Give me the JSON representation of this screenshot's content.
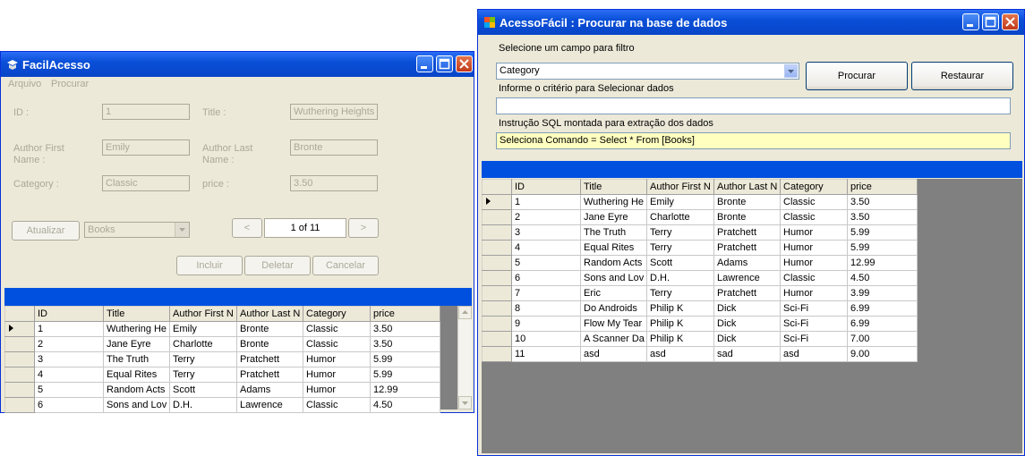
{
  "colors": {
    "title_blue": "#0a4fd8",
    "band_blue": "#0050e0",
    "window_bg": "#ece9d8",
    "sql_bg": "#ffffc0",
    "grid_area": "#808080"
  },
  "left_window": {
    "title": "FacilAcesso",
    "menu": [
      "Arquivo",
      "Procurar"
    ],
    "fields": {
      "id_label": "ID :",
      "id_value": "1",
      "title_label": "Title :",
      "title_value": "Wuthering Heights",
      "author_first_label": "Author First Name :",
      "author_first_value": "Emily",
      "author_last_label": "Author Last Name :",
      "author_last_value": "Bronte",
      "category_label": "Category :",
      "category_value": "Classic",
      "price_label": "price :",
      "price_value": "3.50"
    },
    "atualizar": "Atualizar",
    "table_select": "Books",
    "nav_prev": "<",
    "nav_position": "1 of 11",
    "nav_next": ">",
    "incluir": "Incluir",
    "deletar": "Deletar",
    "cancelar": "Cancelar",
    "grid": {
      "headers": [
        "ID",
        "Title",
        "Author First N",
        "Author Last N",
        "Category",
        "price"
      ],
      "rows": [
        [
          "1",
          "Wuthering He",
          "Emily",
          "Bronte",
          "Classic",
          "3.50"
        ],
        [
          "2",
          "Jane Eyre",
          "Charlotte",
          "Bronte",
          "Classic",
          "3.50"
        ],
        [
          "3",
          "The Truth",
          "Terry",
          "Pratchett",
          "Humor",
          "5.99"
        ],
        [
          "4",
          "Equal Rites",
          "Terry",
          "Pratchett",
          "Humor",
          "5.99"
        ],
        [
          "5",
          "Random Acts",
          "Scott",
          "Adams",
          "Humor",
          "12.99"
        ],
        [
          "6",
          "Sons and Lov",
          "D.H.",
          "Lawrence",
          "Classic",
          "4.50"
        ]
      ]
    }
  },
  "right_window": {
    "title": "AcessoFácil : Procurar na base de dados",
    "filter_label": "Selecione um campo para filtro",
    "filter_value": "Category",
    "procurar": "Procurar",
    "restaurar": "Restaurar",
    "criteria_label": "Informe o critério para Selecionar dados",
    "criteria_value": "",
    "sql_label": "Instrução SQL montada para extração dos dados",
    "sql_value": "Seleciona Comando = Select * From [Books]",
    "grid": {
      "headers": [
        "ID",
        "Title",
        "Author First N",
        "Author Last N",
        "Category",
        "price"
      ],
      "rows": [
        [
          "1",
          "Wuthering He",
          "Emily",
          "Bronte",
          "Classic",
          "3.50"
        ],
        [
          "2",
          "Jane Eyre",
          "Charlotte",
          "Bronte",
          "Classic",
          "3.50"
        ],
        [
          "3",
          "The Truth",
          "Terry",
          "Pratchett",
          "Humor",
          "5.99"
        ],
        [
          "4",
          "Equal Rites",
          "Terry",
          "Pratchett",
          "Humor",
          "5.99"
        ],
        [
          "5",
          "Random Acts",
          "Scott",
          "Adams",
          "Humor",
          "12.99"
        ],
        [
          "6",
          "Sons and Lov",
          "D.H.",
          "Lawrence",
          "Classic",
          "4.50"
        ],
        [
          "7",
          "Eric",
          "Terry",
          "Pratchett",
          "Humor",
          "3.99"
        ],
        [
          "8",
          "Do Androids",
          "Philip K",
          "Dick",
          "Sci-Fi",
          "6.99"
        ],
        [
          "9",
          "Flow My Tear",
          "Philip K",
          "Dick",
          "Sci-Fi",
          "6.99"
        ],
        [
          "10",
          "A Scanner Da",
          "Philip K",
          "Dick",
          "Sci-Fi",
          "7.00"
        ],
        [
          "11",
          "asd",
          "asd",
          "sad",
          "asd",
          "9.00"
        ]
      ]
    }
  }
}
